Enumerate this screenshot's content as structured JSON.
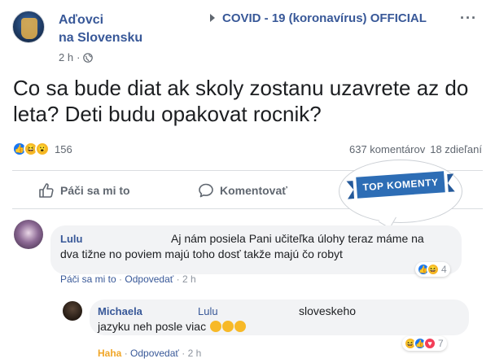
{
  "post": {
    "author_line1": "Aďovci",
    "author_line2": "na Slovensku",
    "time": "2 h",
    "group": "COVID - 19 (koronavírus) OFFICIAL",
    "more": "···",
    "text": "Co sa bude diat ak skoly zostanu uzavrete az do leta? Deti budu opakovat rocnik?",
    "reaction_count": "156",
    "comments_count": "637 komentárov",
    "shares_count": "18 zdieľaní"
  },
  "actions": {
    "like": "Páči sa mi to",
    "comment": "Komentovať"
  },
  "banner": {
    "label": "TOP KOMENTY"
  },
  "comments": [
    {
      "name": "Lulu",
      "text": "Aj nám posiela Pani učiteľka úlohy teraz máme na dva tižne no poviem majú toho dosť takže majú čo robyt",
      "reaction_count": "4",
      "like": "Páči sa mi to",
      "reply": "Odpovedať",
      "time": "2 h"
    },
    {
      "name": "Michaela",
      "mention": "Lulu",
      "text": "sloveskeho jazyku neh posle viac",
      "reaction_count": "7",
      "like": "Haha",
      "reply": "Odpovedať",
      "time": "2 h"
    }
  ],
  "colors": {
    "link": "#385898",
    "muted": "#606770",
    "like_blue": "#1877f2",
    "haha_yellow": "#f7b928",
    "love_red": "#f33e58",
    "banner_blue": "#2d6db5"
  }
}
